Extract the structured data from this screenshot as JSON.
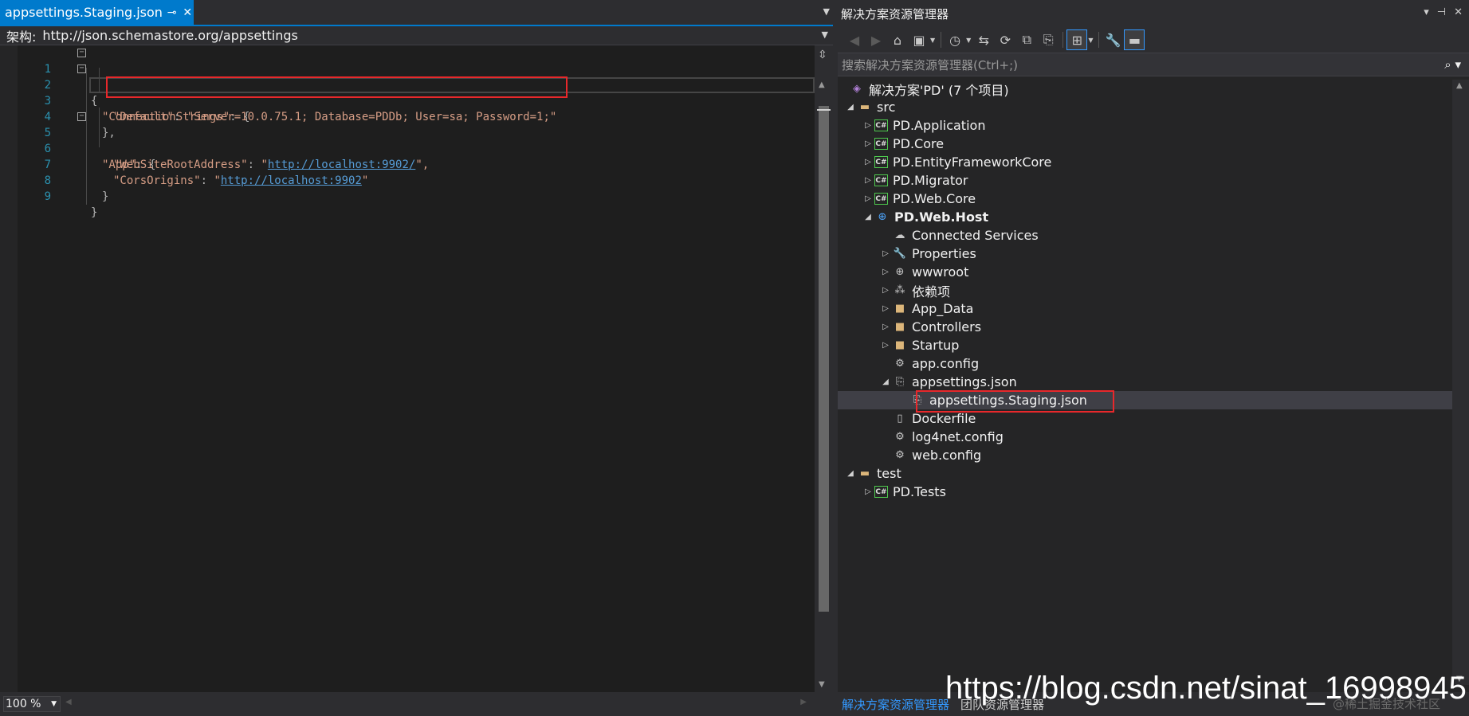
{
  "editor": {
    "tab": {
      "label": "appsettings.Staging.json",
      "pin": "⊸",
      "close": "✕"
    },
    "schema": {
      "label": "架构:",
      "value": "http://json.schemastore.org/appsettings"
    },
    "lines": [
      {
        "n": "1",
        "text": "{"
      },
      {
        "n": "2",
        "key": "\"ConnectionStrings\"",
        "rest": ": {"
      },
      {
        "n": "3",
        "key": "\"Default\"",
        "sep": ": ",
        "val": "\"Server=10.0.75.1; Database=PDDb; User=sa; Password=1;\""
      },
      {
        "n": "4",
        "text": "},"
      },
      {
        "n": "5",
        "key": "\"App\"",
        "rest": ": {"
      },
      {
        "n": "6",
        "key": "\"WebSiteRootAddress\"",
        "sep": ": ",
        "q1": "\"",
        "url": "http://localhost:9902/",
        "q2": "\","
      },
      {
        "n": "7",
        "key": "\"CorsOrigins\"",
        "sep": ": ",
        "q1": "\"",
        "url": "http://localhost:9902",
        "q2": "\""
      },
      {
        "n": "8",
        "text": "}"
      },
      {
        "n": "9",
        "text": "}"
      }
    ],
    "zoom": "100 %"
  },
  "explorer": {
    "title": "解决方案资源管理器",
    "title_buttons": [
      "▾",
      "⊣",
      "✕"
    ],
    "search_placeholder": "搜索解决方案资源管理器(Ctrl+;)",
    "tree": [
      {
        "label": "解决方案'PD' (7 个项目)",
        "icon": "solution-icon"
      },
      {
        "label": "src",
        "icon": "folder-icon"
      },
      {
        "label": "PD.Application",
        "icon": "csharp-project-icon"
      },
      {
        "label": "PD.Core",
        "icon": "csharp-project-icon"
      },
      {
        "label": "PD.EntityFrameworkCore",
        "icon": "csharp-project-icon"
      },
      {
        "label": "PD.Migrator",
        "icon": "csharp-project-icon"
      },
      {
        "label": "PD.Web.Core",
        "icon": "csharp-project-icon"
      },
      {
        "label": "PD.Web.Host",
        "icon": "web-project-icon"
      },
      {
        "label": "Connected Services",
        "icon": "cloud-icon"
      },
      {
        "label": "Properties",
        "icon": "wrench-icon"
      },
      {
        "label": "wwwroot",
        "icon": "globe-icon"
      },
      {
        "label": "依赖项",
        "icon": "dependencies-icon"
      },
      {
        "label": "App_Data",
        "icon": "folder-icon"
      },
      {
        "label": "Controllers",
        "icon": "folder-icon"
      },
      {
        "label": "Startup",
        "icon": "folder-icon"
      },
      {
        "label": "app.config",
        "icon": "config-file-icon"
      },
      {
        "label": "appsettings.json",
        "icon": "json-file-icon"
      },
      {
        "label": "appsettings.Staging.json",
        "icon": "json-file-icon"
      },
      {
        "label": "Dockerfile",
        "icon": "file-icon"
      },
      {
        "label": "log4net.config",
        "icon": "config-file-icon"
      },
      {
        "label": "web.config",
        "icon": "config-file-icon"
      },
      {
        "label": "test",
        "icon": "folder-icon"
      },
      {
        "label": "PD.Tests",
        "icon": "csharp-project-icon"
      }
    ],
    "bottom_tabs": [
      "解决方案资源管理器",
      "团队资源管理器"
    ]
  },
  "watermark": "https://blog.csdn.net/sinat_16998945",
  "watermark2": "@稀土掘金技术社区",
  "colors": {
    "accent": "#007acc",
    "highlight": "#e8282b",
    "csharp": "#4ec94e",
    "folder": "#dcb67a"
  }
}
